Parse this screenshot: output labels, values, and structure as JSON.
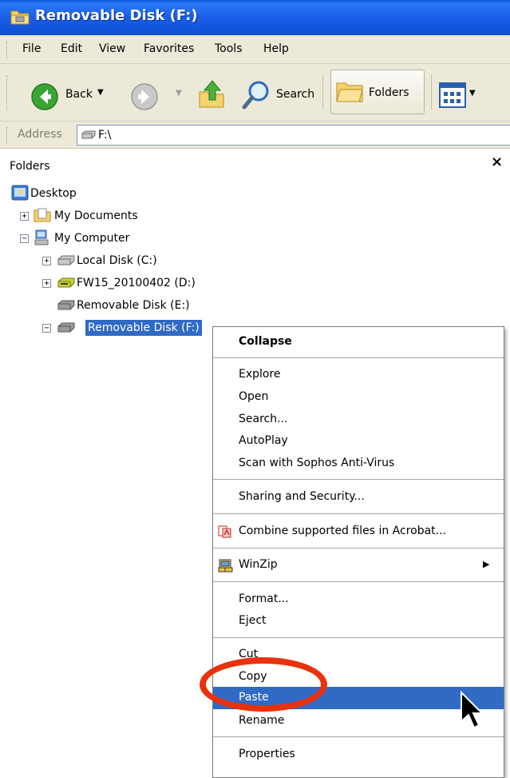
{
  "window": {
    "title": "Removable Disk (F:)"
  },
  "menubar": {
    "items": [
      "File",
      "Edit",
      "View",
      "Favorites",
      "Tools",
      "Help"
    ]
  },
  "toolbar": {
    "back_label": "Back",
    "search_label": "Search",
    "folders_label": "Folders"
  },
  "address": {
    "label": "Address",
    "value": "F:\\"
  },
  "pane": {
    "title": "Folders",
    "close_glyph": "×"
  },
  "tree": {
    "desktop": "Desktop",
    "my_documents": "My Documents",
    "my_computer": "My Computer",
    "local_disk_c": "Local Disk (C:)",
    "dvd_d": "FW15_20100402 (D:)",
    "removable_e": "Removable Disk (E:)",
    "removable_f": "Removable Disk (F:)"
  },
  "context_menu": {
    "collapse": "Collapse",
    "explore": "Explore",
    "open": "Open",
    "search": "Search...",
    "autoplay": "AutoPlay",
    "scan": "Scan with Sophos Anti-Virus",
    "sharing": "Sharing and Security...",
    "combine": "Combine supported files in Acrobat...",
    "winzip": "WinZip",
    "format": "Format...",
    "eject": "Eject",
    "cut": "Cut",
    "copy": "Copy",
    "paste": "Paste",
    "rename": "Rename",
    "properties": "Properties"
  },
  "colors": {
    "selection": "#316ac5",
    "annotation": "#e8320e",
    "titlebar": "#1a5ee8"
  }
}
